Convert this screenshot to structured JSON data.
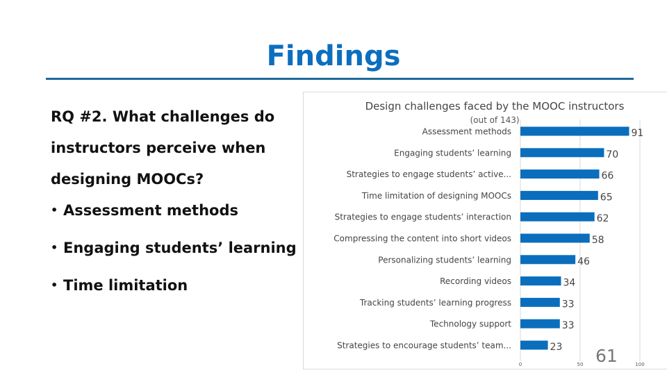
{
  "slide": {
    "title": "Findings",
    "question": "RQ #2. What challenges do instructors perceive when designing MOOCs?",
    "bullets": [
      "Assessment methods",
      "Engaging students’ learning",
      "Time limitation"
    ],
    "slide_number": "61",
    "colors": {
      "title": "#0c6ebf",
      "rule": "#1e6a9b",
      "bar": "#0a6ebd"
    }
  },
  "chart_data": {
    "type": "bar",
    "orientation": "horizontal",
    "title": "Design challenges faced by the MOOC instructors",
    "subtitle": "(out of 143)",
    "xlabel": "",
    "ylabel": "",
    "categories": [
      "Assessment methods",
      "Engaging students’ learning",
      "Strategies to engage students’ active...",
      "Time limitation of designing MOOCs",
      "Strategies to engage students’ interaction",
      "Compressing the content into short videos",
      "Personalizing students’ learning",
      "Recording videos",
      "Tracking students’ learning progress",
      "Technology support",
      "Strategies to encourage students’ team..."
    ],
    "values": [
      91,
      70,
      66,
      65,
      62,
      58,
      46,
      34,
      33,
      33,
      23
    ],
    "xlim": [
      0,
      100
    ],
    "xticks": [
      0,
      50,
      100
    ],
    "grid": true,
    "legend": "none",
    "data_labels": true
  }
}
